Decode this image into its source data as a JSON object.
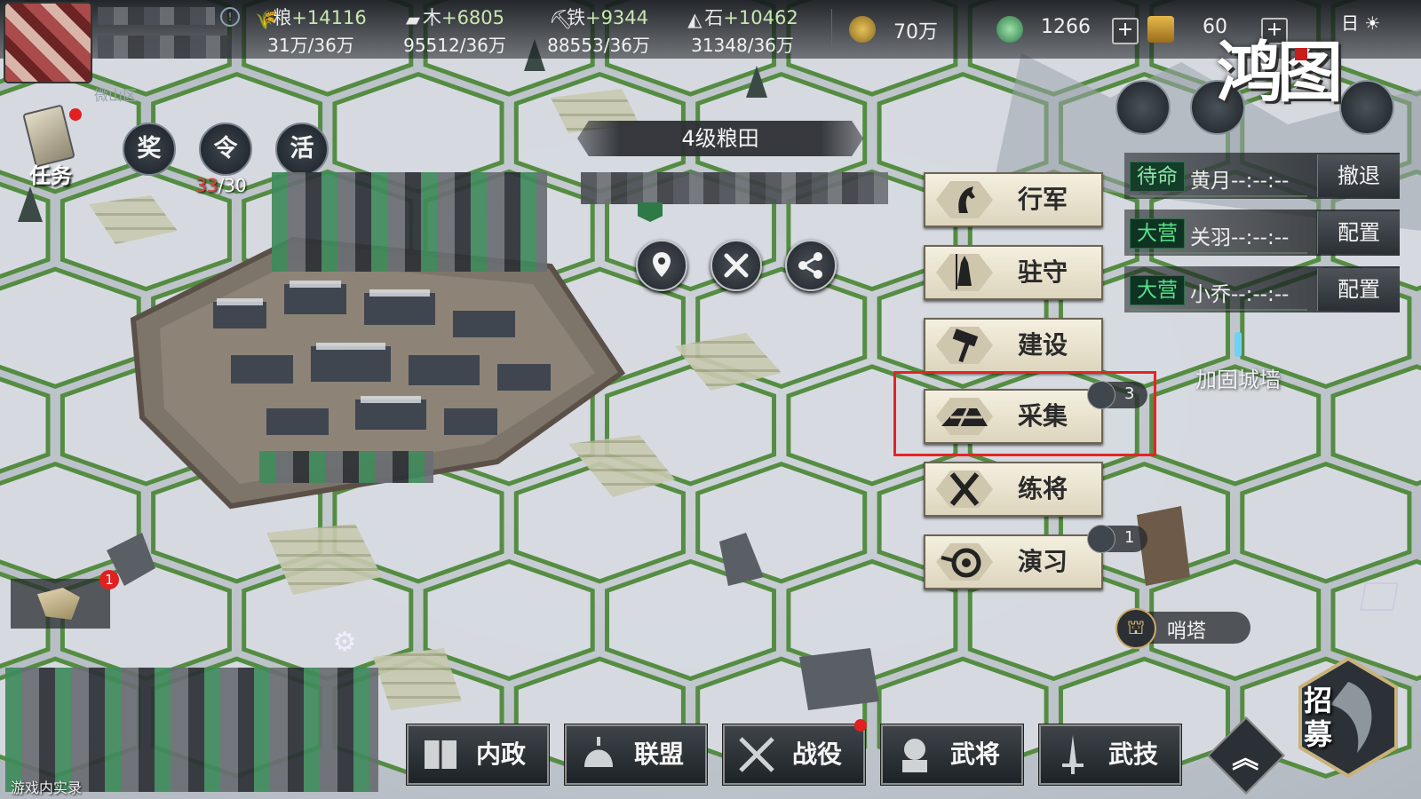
{
  "resources": [
    {
      "name": "粮",
      "gain": "+14116",
      "amount": "31万/36万"
    },
    {
      "name": "木",
      "gain": "+6805",
      "amount": "95512/36万"
    },
    {
      "name": "铁",
      "gain": "+9344",
      "amount": "88553/36万"
    },
    {
      "name": "石",
      "gain": "+10462",
      "amount": "31348/36万"
    }
  ],
  "currency": {
    "copper": "70万",
    "jade": "1266",
    "gold": "60"
  },
  "time_of_day": "日",
  "game_logo": "鸿图",
  "region_partial": "微山区",
  "left_buttons": {
    "task": "任务",
    "reward": "奖",
    "order": "令",
    "activity": "活"
  },
  "order_counter": {
    "current": "33",
    "max": "/30"
  },
  "tile": {
    "title": "4级粮田"
  },
  "actions": [
    {
      "id": "march",
      "label": "行军",
      "icon": "horse-icon"
    },
    {
      "id": "garrison",
      "label": "驻守",
      "icon": "guard-icon"
    },
    {
      "id": "build",
      "label": "建设",
      "icon": "hammer-icon"
    },
    {
      "id": "gather",
      "label": "采集",
      "icon": "field-icon",
      "badge": "3"
    },
    {
      "id": "train",
      "label": "练将",
      "icon": "swords-icon"
    },
    {
      "id": "drill",
      "label": "演习",
      "icon": "drill-icon",
      "badge": "1"
    }
  ],
  "troops": [
    {
      "status": "待命",
      "name": "黄月--:--:--",
      "action": "撤退"
    },
    {
      "status": "大营",
      "name": "关羽--:--:--",
      "action": "配置"
    },
    {
      "status": "大营",
      "name": "小乔--:--:--",
      "action": "配置"
    }
  ],
  "map_labels": {
    "reinforce_wall": "加固城墙",
    "watchtower": "哨塔"
  },
  "badges": {
    "map_notice": "1"
  },
  "bottom_nav": [
    {
      "id": "internal",
      "label": "内政",
      "icon": "book-icon"
    },
    {
      "id": "alliance",
      "label": "联盟",
      "icon": "helmet-icon"
    },
    {
      "id": "campaign",
      "label": "战役",
      "icon": "crossed-swords-icon"
    },
    {
      "id": "generals",
      "label": "武将",
      "icon": "general-icon"
    },
    {
      "id": "skills",
      "label": "武技",
      "icon": "sword-icon"
    }
  ],
  "recruit": "招募",
  "footer_note": "游戏内实录",
  "colors": {
    "highlight": "#e52424",
    "status_green": "#57e08a",
    "order_red": "#e8403a"
  }
}
